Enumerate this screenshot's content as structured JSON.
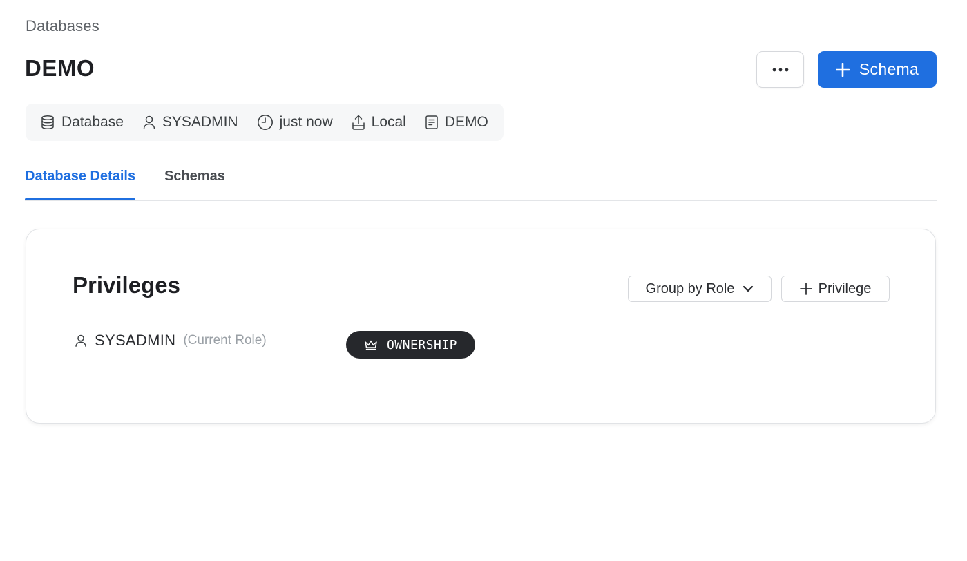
{
  "breadcrumb": "Databases",
  "page_title": "DEMO",
  "header_actions": {
    "more_icon": "ellipsis-horizontal-icon",
    "primary_icon": "plus-icon",
    "primary_label": "Schema"
  },
  "meta": [
    {
      "icon": "database-icon",
      "label": "Database"
    },
    {
      "icon": "user-icon",
      "label": "SYSADMIN"
    },
    {
      "icon": "clock-icon",
      "label": "just now"
    },
    {
      "icon": "upload-icon",
      "label": "Local"
    },
    {
      "icon": "document-icon",
      "label": "DEMO"
    }
  ],
  "tabs": [
    {
      "label": "Database Details",
      "active": true
    },
    {
      "label": "Schemas",
      "active": false
    }
  ],
  "privileges": {
    "title": "Privileges",
    "group_by_label": "Group by Role",
    "add_label": "Privilege",
    "rows": [
      {
        "role": "SYSADMIN",
        "note": "(Current Role)",
        "privilege": "OWNERSHIP",
        "privilege_icon": "crown-icon"
      }
    ]
  },
  "colors": {
    "accent": "#1f6fe0",
    "badge_bg": "#26282c",
    "meta_bg": "#f6f7f8"
  }
}
